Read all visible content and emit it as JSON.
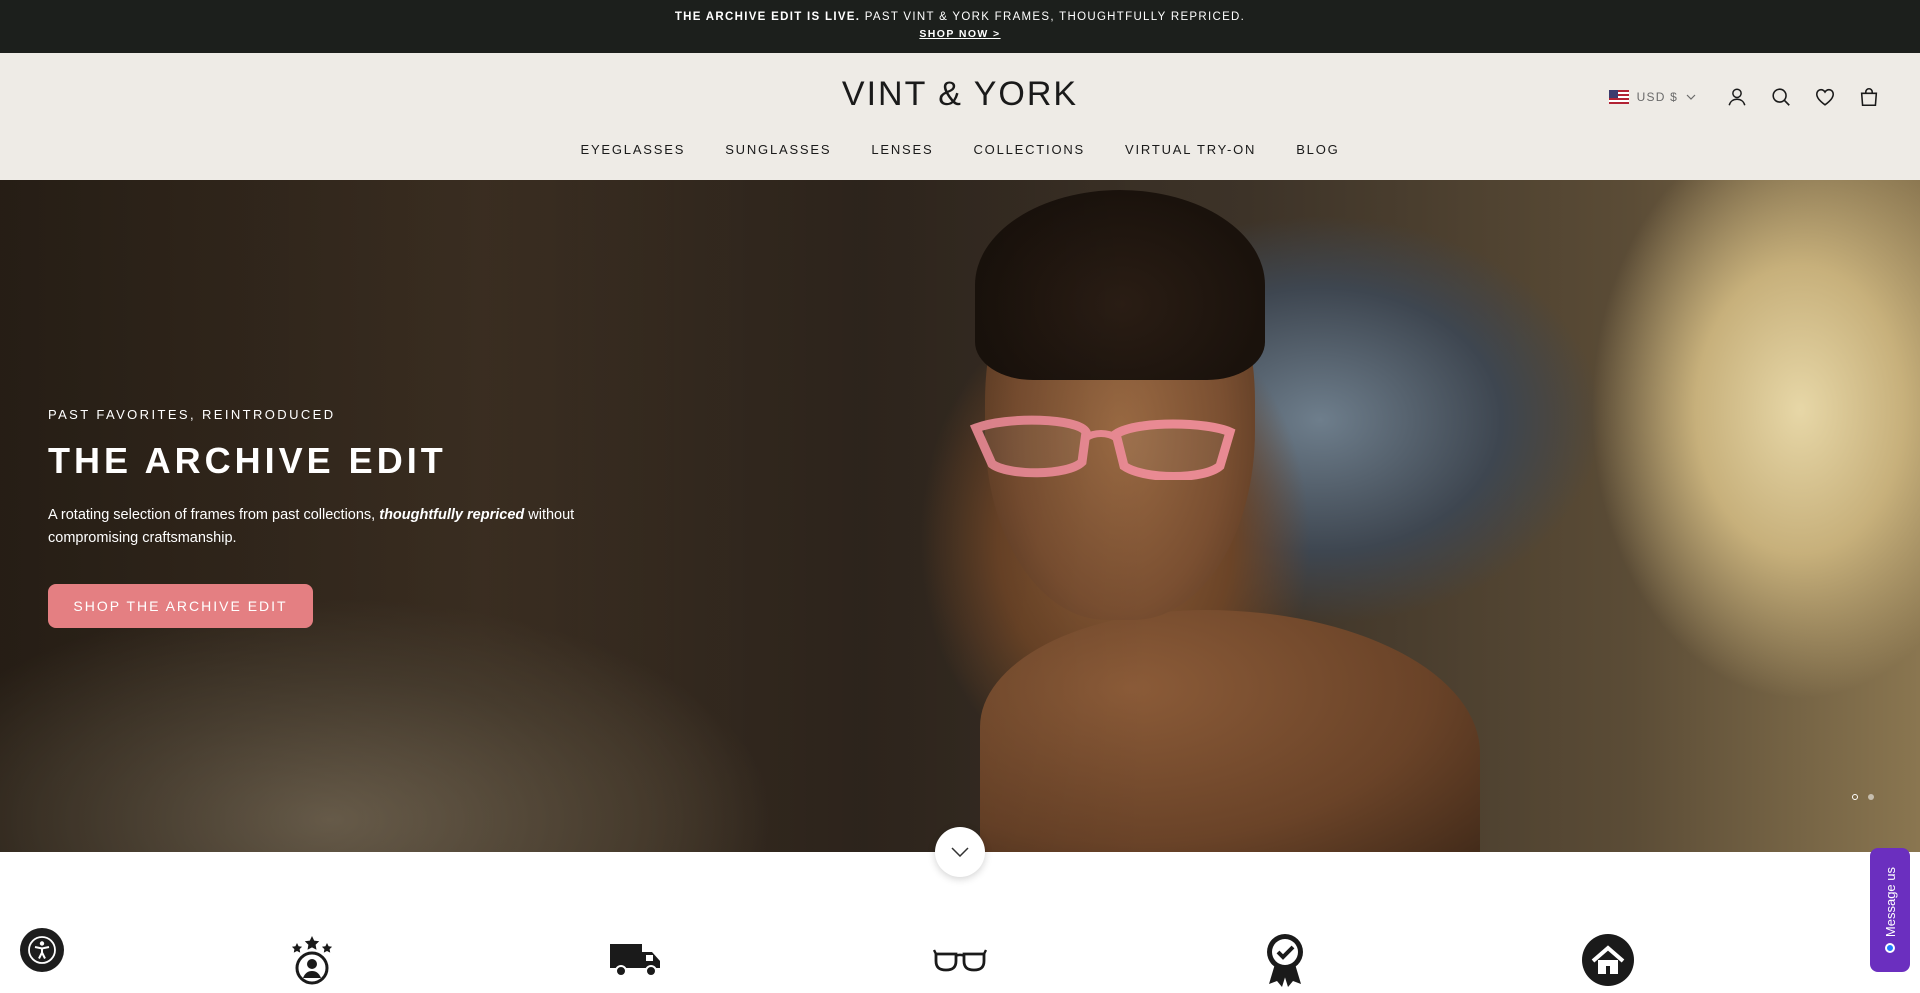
{
  "announcement": {
    "bold": "THE ARCHIVE EDIT IS LIVE.",
    "text": " PAST VINT & YORK FRAMES, THOUGHTFULLY REPRICED.",
    "link": "SHOP NOW >"
  },
  "header": {
    "logo": "VINT & YORK",
    "nav": [
      "EYEGLASSES",
      "SUNGLASSES",
      "LENSES",
      "COLLECTIONS",
      "VIRTUAL TRY-ON",
      "BLOG"
    ],
    "currency": "USD $",
    "icons": [
      "account-icon",
      "search-icon",
      "wishlist-heart-icon",
      "cart-bag-icon"
    ]
  },
  "hero": {
    "eyebrow": "PAST FAVORITES, REINTRODUCED",
    "title": "THE ARCHIVE EDIT",
    "desc_before": "A rotating selection of frames from past collections, ",
    "desc_emphasis": "thoughtfully repriced",
    "desc_after": " without compromising craftsmanship.",
    "button": "SHOP THE ARCHIVE EDIT",
    "slides": 2,
    "active_slide": 1
  },
  "features": {
    "icons": [
      "star-person-icon",
      "delivery-truck-icon",
      "eyeglasses-icon",
      "award-badge-icon",
      "home-icon"
    ]
  },
  "chat": {
    "label": "Message us"
  },
  "colors": {
    "announce_bg": "#1c1f1c",
    "header_bg": "#eeebe6",
    "button_bg": "#e47f82",
    "chat_bg": "#6b2fbf"
  }
}
